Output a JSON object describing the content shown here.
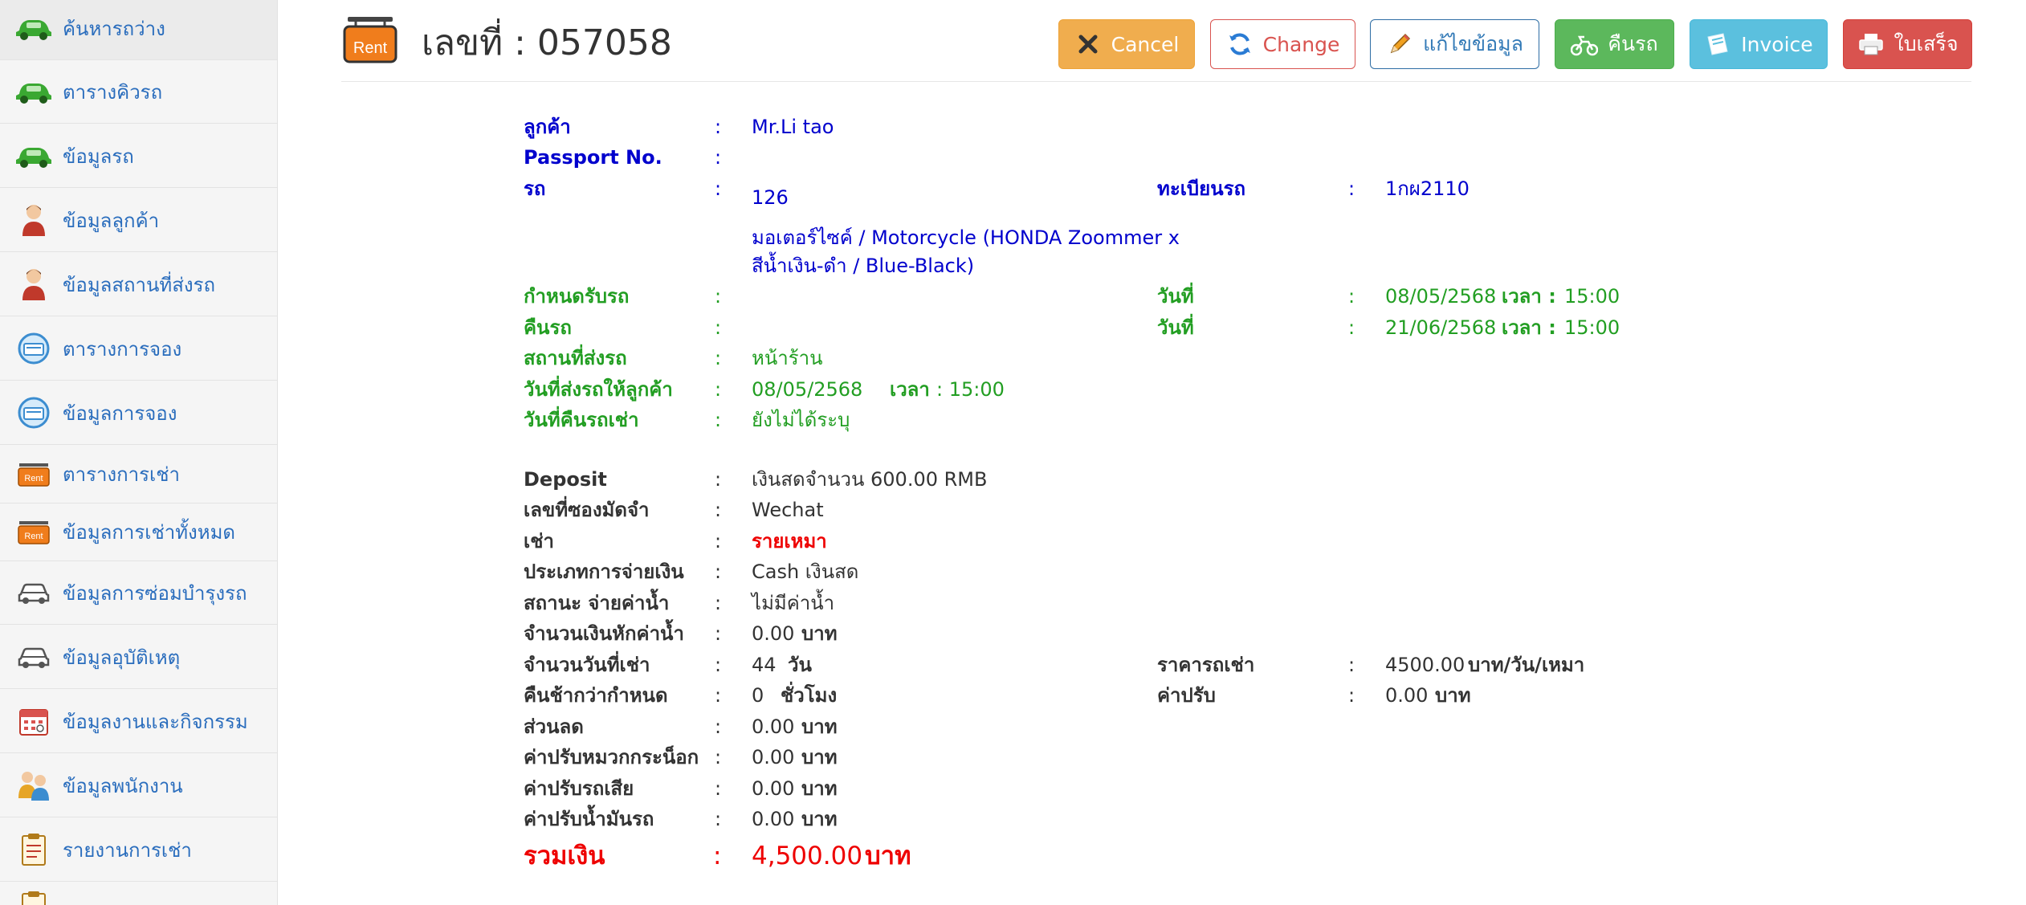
{
  "sidebar": {
    "items": [
      {
        "label": "ค้นหารถว่าง",
        "icon": "car-icon"
      },
      {
        "label": "ตารางคิวรถ",
        "icon": "car-icon"
      },
      {
        "label": "ข้อมูลรถ",
        "icon": "car-icon"
      },
      {
        "label": "ข้อมูลลูกค้า",
        "icon": "person-icon"
      },
      {
        "label": "ข้อมูลสถานที่ส่งรถ",
        "icon": "person-icon"
      },
      {
        "label": "ตารางการจอง",
        "icon": "booking-icon"
      },
      {
        "label": "ข้อมูลการจอง",
        "icon": "booking-icon"
      },
      {
        "label": "ตารางการเช่า",
        "icon": "rent-sign-icon"
      },
      {
        "label": "ข้อมูลการเช่าทั้งหมด",
        "icon": "rent-sign-icon"
      },
      {
        "label": "ข้อมูลการซ่อมบำรุงรถ",
        "icon": "car-outline-icon"
      },
      {
        "label": "ข้อมูลอุบัติเหตุ",
        "icon": "car-outline-icon"
      },
      {
        "label": "ข้อมูลงานและกิจกรรม",
        "icon": "calendar-icon"
      },
      {
        "label": "ข้อมูลพนักงาน",
        "icon": "staff-icon"
      },
      {
        "label": "รายงานการเช่า",
        "icon": "report-icon"
      }
    ]
  },
  "header": {
    "logo_text": "Rent",
    "title": "เลขที่ : 057058"
  },
  "buttons": {
    "cancel": "Cancel",
    "change": "Change",
    "edit": "แก้ไขข้อมูล",
    "return_car": "คืนรถ",
    "invoice": "Invoice",
    "receipt": "ใบเสร็จ"
  },
  "detail": {
    "colon": ":",
    "customer_label": "ลูกค้า",
    "customer_value": "Mr.Li tao",
    "passport_label": "Passport No.",
    "passport_value": "",
    "car_label": "รถ",
    "car_number": "126",
    "car_desc_line1": "มอเตอร์ไซค์ / Motorcycle (HONDA Zoommer x",
    "car_desc_line2": "สีน้ำเงิน-ดำ / Blue-Black)",
    "plate_label": "ทะเบียนรถ",
    "plate_value": "1กผ2110",
    "pickup_label": "กำหนดรับรถ",
    "return_label": "คืนรถ",
    "date_label": "วันที่",
    "time_label": "เวลา :",
    "pickup_date": "08/05/2568",
    "pickup_time": "15:00",
    "return_date": "21/06/2568",
    "return_time": "15:00",
    "delivery_place_label": "สถานที่ส่งรถ",
    "delivery_place_value": "หน้าร้าน",
    "delivery_date_label": "วันที่ส่งรถให้ลูกค้า",
    "delivery_date_value": "08/05/2568",
    "delivery_time_label": "เวลา",
    "delivery_time_value": ": 15:00",
    "return_actual_label": "วันที่คืนรถเช่า",
    "return_actual_value": "ยังไม่ได้ระบุ",
    "deposit_label": "Deposit",
    "deposit_value": "เงินสดจำนวน 600.00 RMB",
    "deposit_channel_label": "เลขที่ซองมัดจำ",
    "deposit_channel_value": "Wechat",
    "rent_type_label": "เช่า",
    "rent_type_value": "รายเหมา",
    "payment_type_label": "ประเภทการจ่ายเงิน",
    "payment_type_value": "Cash เงินสด",
    "water_status_label": "สถานะ จ่ายค่าน้ำ",
    "water_status_value": "ไม่มีค่าน้ำ",
    "water_deduct_label": "จำนวนเงินหักค่าน้ำ",
    "water_deduct_value": "0.00",
    "baht": "บาท",
    "days_label": "จำนวนวันที่เช่า",
    "days_value": "44",
    "days_unit": "วัน",
    "price_label": "ราคารถเช่า",
    "price_value": "4500.00",
    "price_unit": "บาท/วัน/เหมา",
    "late_label": "คืนช้ากว่ากำหนด",
    "late_value": "0",
    "late_unit": "ชั่วโมง",
    "fine_label": "ค่าปรับ",
    "fine_value": "0.00",
    "discount_label": "ส่วนลด",
    "discount_value": "0.00",
    "helmet_fine_label": "ค่าปรับหมวกกระน็อก",
    "helmet_fine_value": "0.00",
    "damage_fine_label": "ค่าปรับรถเสีย",
    "damage_fine_value": "0.00",
    "fuel_fine_label": "ค่าปรับน้ำมันรถ",
    "fuel_fine_value": "0.00",
    "total_label": "รวมเงิน",
    "total_value": "4,500.00",
    "total_unit": "บาท"
  },
  "colors": {
    "blue_text": "#0000cd",
    "green_text": "#229e22",
    "red_text": "#ee0000",
    "sidebar_link": "#2a6dbd"
  }
}
